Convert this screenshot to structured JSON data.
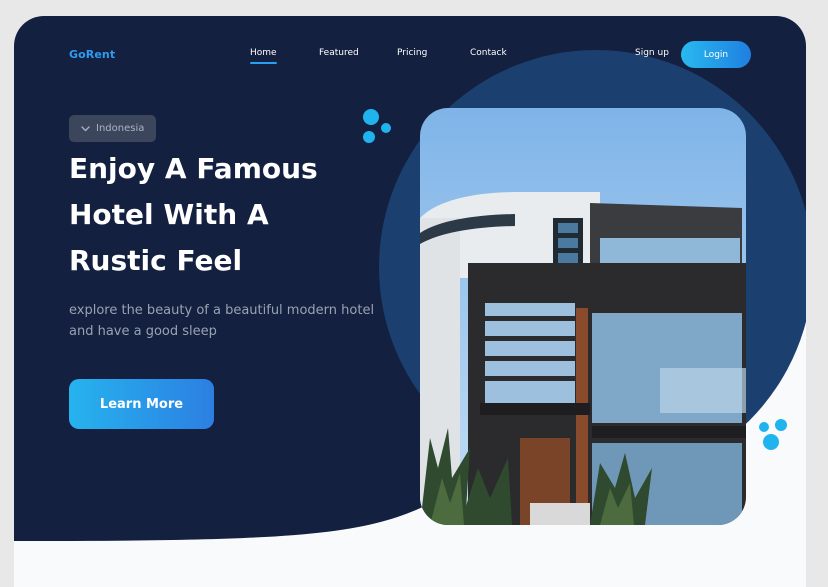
{
  "brand": {
    "logo_text": "GoRent"
  },
  "nav": {
    "items": [
      {
        "label": "Home",
        "active": true
      },
      {
        "label": "Featured",
        "active": false
      },
      {
        "label": "Pricing",
        "active": false
      },
      {
        "label": "Contack",
        "active": false
      }
    ]
  },
  "auth": {
    "signup_label": "Sign up",
    "login_label": "Login"
  },
  "hero": {
    "location_label": "Indonesia",
    "title_lines": [
      "Enjoy A Famous",
      "Hotel With A",
      "Rustic Feel"
    ],
    "subtitle": "explore the beauty of a beautiful modern hotel and have a good sleep",
    "cta_label": "Learn More"
  },
  "colors": {
    "hero_background": "#142040",
    "accent": "#2a9df4",
    "dots": "#20b4ee"
  },
  "icons": {
    "location_toggle": "chevron-down-icon"
  }
}
